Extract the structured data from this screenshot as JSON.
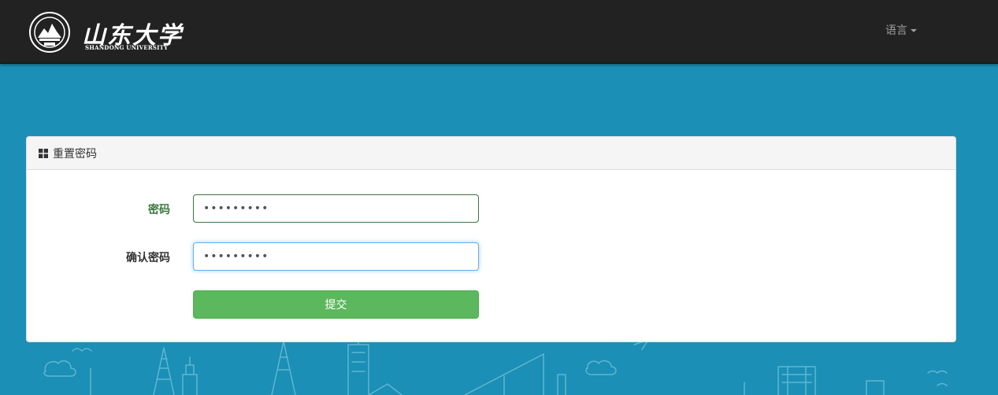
{
  "navbar": {
    "logo_text": "山东大学",
    "logo_subtitle": "SHANDONG UNIVERSITY",
    "language_label": "语言"
  },
  "panel": {
    "heading": "重置密码",
    "heading_icon": "th-large-icon"
  },
  "form": {
    "password_label": "密码",
    "password_value": "•••••••••",
    "confirm_label": "确认密码",
    "confirm_value": "•••••••••",
    "submit_label": "提交"
  },
  "colors": {
    "page_bg": "#1b8fb5",
    "navbar_bg": "#222222",
    "success_label": "#3c763d",
    "submit_bg": "#5cb85c",
    "focus_border": "#66afe9"
  }
}
